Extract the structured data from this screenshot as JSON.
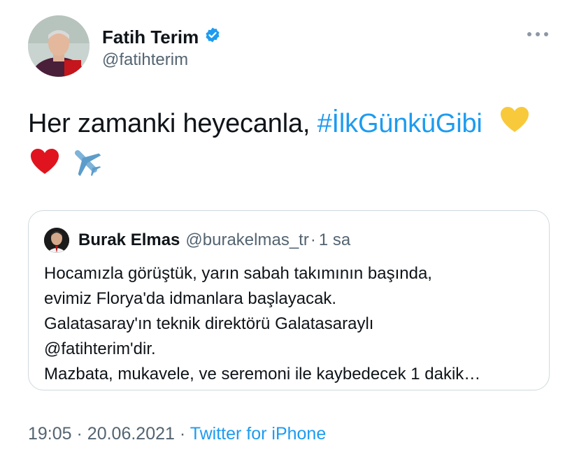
{
  "author": {
    "name": "Fatih Terim",
    "handle": "@fatihterim",
    "verified": true
  },
  "tweet": {
    "text_prefix": "Her zamanki heyecanla, ",
    "hashtag": "#İlkGünküGibi",
    "emojis": [
      "yellow-heart-icon",
      "red-heart-icon",
      "airplane-icon"
    ]
  },
  "quoted_tweet": {
    "author_name": "Burak Elmas",
    "author_handle": "@burakelmas_tr",
    "separator": "·",
    "time": "1 sa",
    "lines": [
      "Hocamızla görüştük, yarın sabah takımının başında,",
      "evimiz Florya'da idmanlara başlayacak.",
      "Galatasaray'ın teknik direktörü Galatasaraylı",
      "@fatihterim'dir.",
      "Mazbata, mukavele, ve seremoni ile kaybedecek 1 dakik…"
    ]
  },
  "footer": {
    "time": "19:05",
    "sep1": "·",
    "date": "20.06.2021",
    "sep2": "·",
    "source": "Twitter for iPhone"
  },
  "colors": {
    "accent": "#1d9bf0",
    "secondary_text": "#536471",
    "border": "#cfd9de"
  }
}
